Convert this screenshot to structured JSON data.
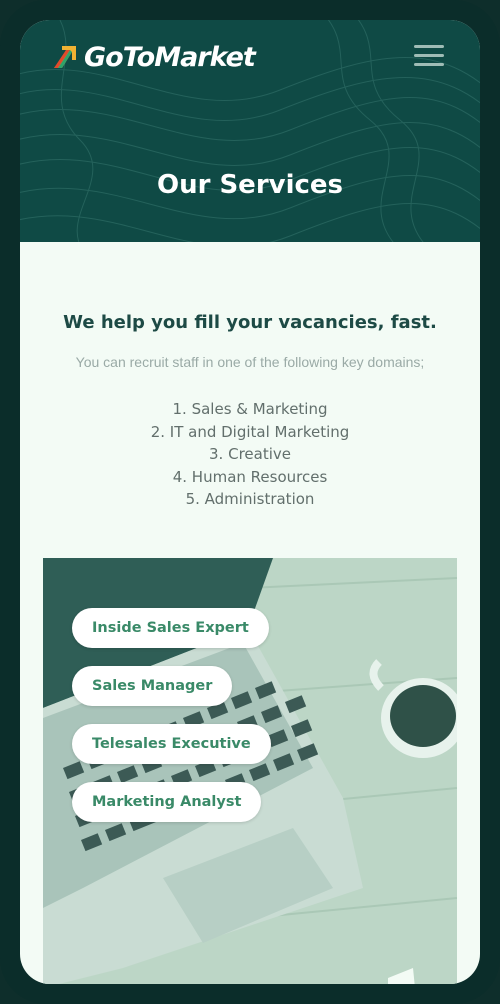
{
  "header": {
    "logo_text": "GoToMarket",
    "page_title": "Our Services"
  },
  "intro": {
    "headline": "We help you fill your vacancies, fast.",
    "subline": "You can recruit staff in one of the following key domains;"
  },
  "domains": [
    "1.  Sales & Marketing",
    "2. IT and Digital Marketing",
    "3. Creative",
    "4. Human Resources",
    "5. Administration"
  ],
  "roles": [
    "Inside Sales Expert",
    "Sales Manager",
    "Telesales Executive",
    "Marketing Analyst"
  ],
  "colors": {
    "header_bg": "#0f4a45",
    "frame": "#0b2d2a",
    "accent_green": "#3a8a68",
    "page_bg": "#f3fbf5"
  },
  "icons": {
    "logo": "gotomarket-logo-icon",
    "menu": "hamburger-menu-icon"
  }
}
